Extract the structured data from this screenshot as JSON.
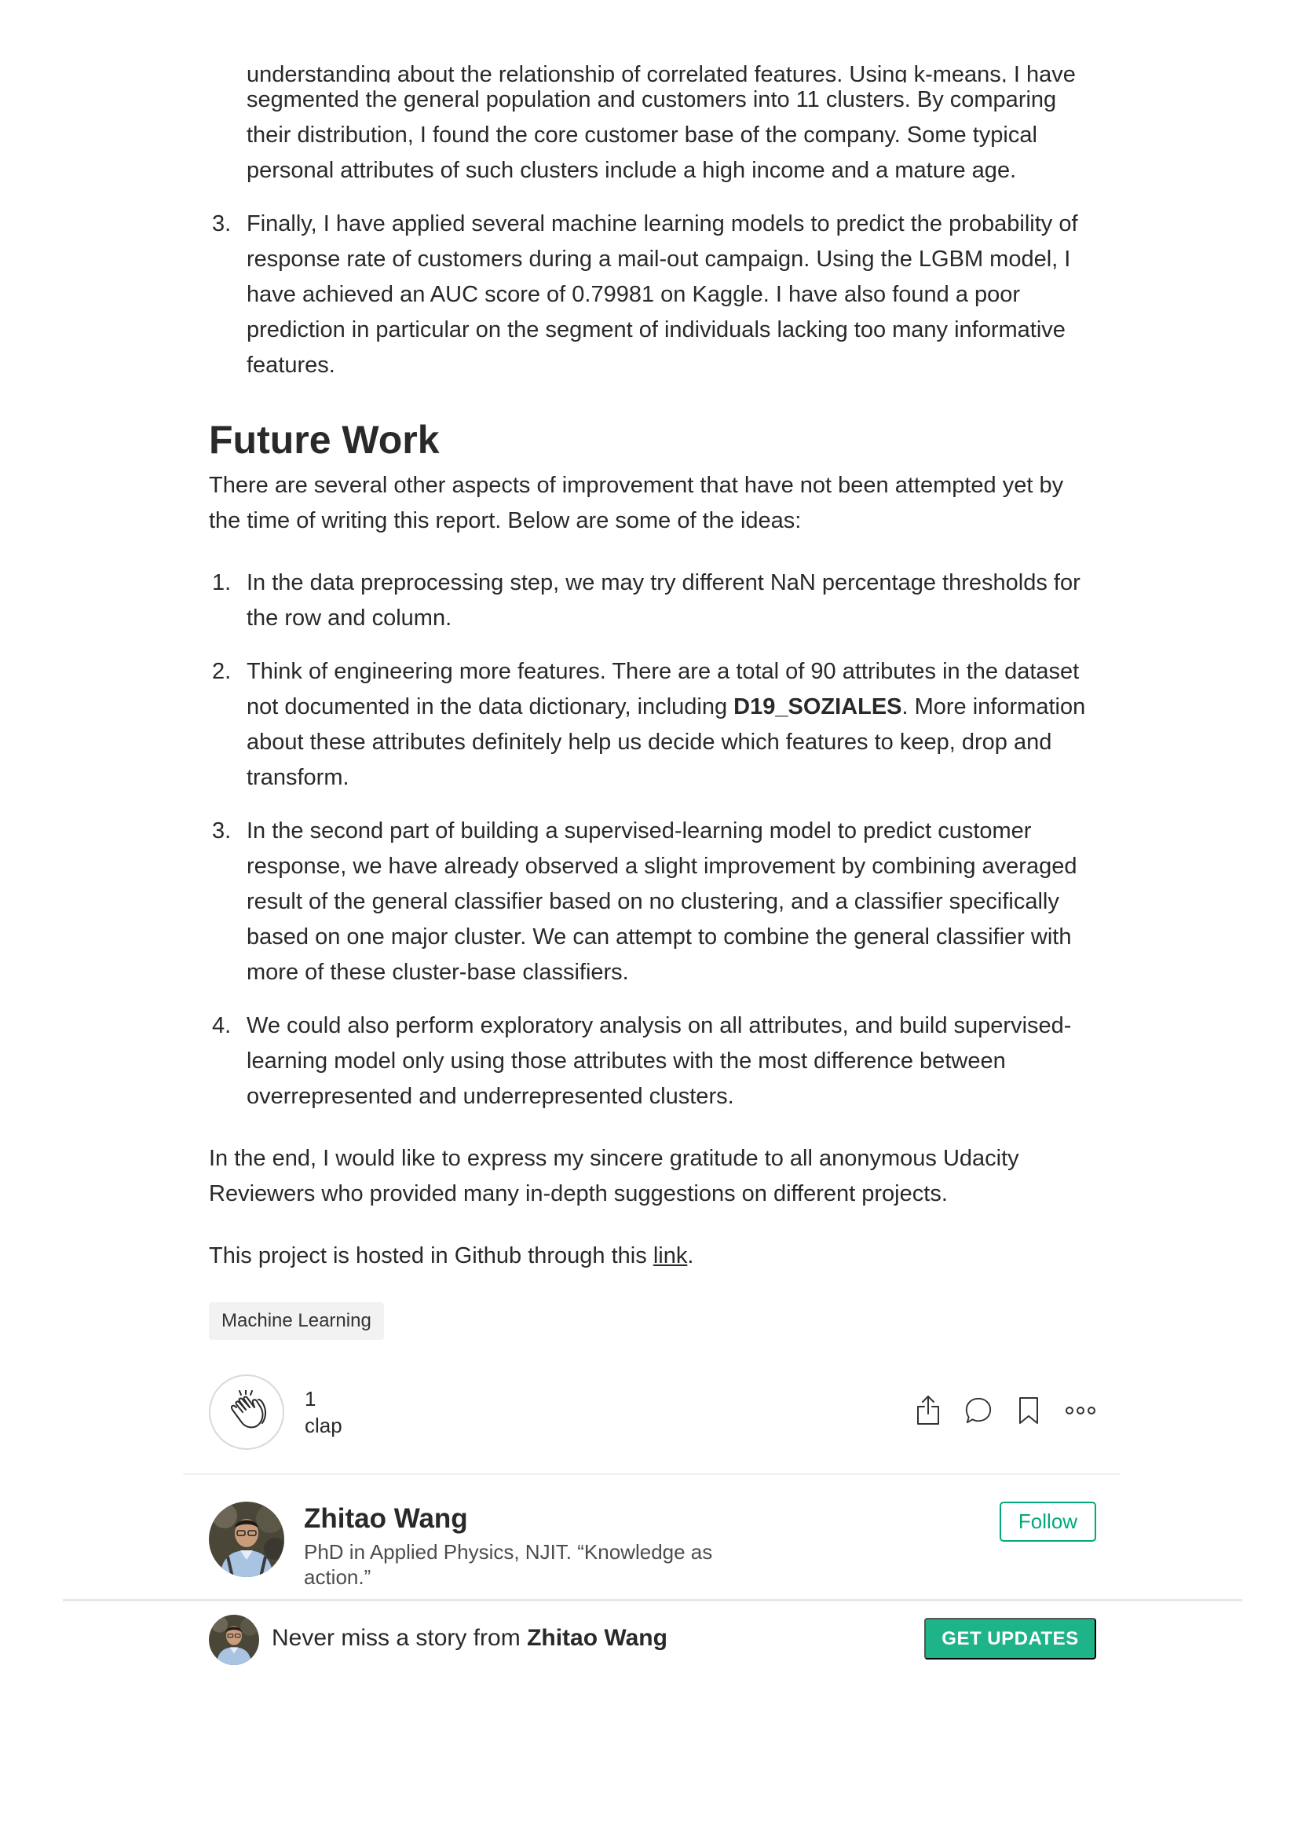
{
  "article": {
    "clipped_line": "understanding about the relationship of correlated features. Using k-means, I have",
    "continuation": "segmented the general population and customers into 11 clusters. By comparing their distribution, I found the core customer base of the company. Some typical personal attributes of such clusters include a high income and a mature age.",
    "conclusion_item3": {
      "number": "3.",
      "text": "Finally, I have applied several machine learning models to predict the probability of response rate of customers during a mail-out campaign. Using the LGBM model, I have achieved an AUC score of 0.79981 on Kaggle. I have also found a poor prediction in particular on the segment of individuals lacking too many informative features."
    },
    "future_heading": "Future Work",
    "future_intro": "There are several other aspects of improvement that have not been attempted yet by the time of writing this report. Below are some of the ideas:",
    "future_items": [
      {
        "number": "1.",
        "text": "In the data preprocessing step, we may try different NaN percentage thresholds for the row and column."
      },
      {
        "number": "2.",
        "before": "Think of engineering more features. There are a total of 90 attributes in the dataset not documented in the data dictionary, including ",
        "bold": "D19_SOZIALES",
        "after": ". More information about these attributes definitely help us decide which features to keep, drop and transform."
      },
      {
        "number": "3.",
        "text": "In the second part of building a supervised-learning model to predict customer response, we have already observed a slight improvement by combining averaged result of the general classifier based on no clustering, and a classifier specifically based on one major cluster. We can attempt to combine the general classifier with more of these cluster-base classifiers."
      },
      {
        "number": "4.",
        "text": "We could also perform exploratory analysis on all attributes, and build supervised-learning model only using those attributes with the most difference between overrepresented and underrepresented clusters."
      }
    ],
    "gratitude": "In the end, I would like to express my sincere gratitude to all anonymous Udacity Reviewers who provided many in-depth suggestions on different projects.",
    "hosted_before": "This project is hosted in Github through this ",
    "hosted_link": "link",
    "hosted_after": "."
  },
  "tags": [
    "Machine Learning"
  ],
  "claps": {
    "count": "1",
    "label": "clap"
  },
  "icons": [
    "clap-icon",
    "share-icon",
    "comment-icon",
    "bookmark-icon",
    "more-icon"
  ],
  "author": {
    "name": "Zhitao Wang",
    "bio": "PhD in Applied Physics, NJIT. “Knowledge as action.”",
    "follow_label": "Follow"
  },
  "bottom_bar": {
    "prefix": "Never miss a story from ",
    "author": "Zhitao Wang",
    "button_label": "GET UPDATES"
  },
  "colors": {
    "accent": "#03a87c",
    "button": "#1eb388",
    "text": "#292929"
  }
}
